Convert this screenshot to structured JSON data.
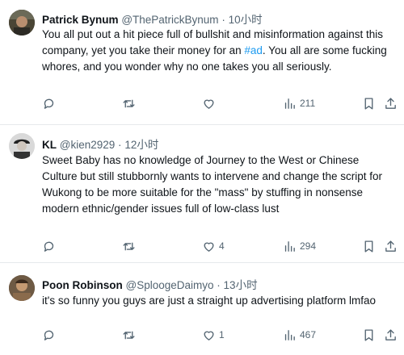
{
  "tweets": [
    {
      "display_name": "Patrick Bynum",
      "handle": "@ThePatrickBynum",
      "separator": "·",
      "time": "10小时",
      "text_before": "You all put out a hit piece full of bullshit and misinformation against this company, yet you take their money for an ",
      "hashtag": "#ad",
      "text_after": ". You all are some fucking whores, and you wonder why no one takes you all seriously.",
      "reply_count": "",
      "retweet_count": "",
      "like_count": "",
      "views_count": "211"
    },
    {
      "display_name": "KL",
      "handle": "@kien2929",
      "separator": "·",
      "time": "12小时",
      "text_before": "Sweet Baby has no knowledge of Journey to the West or Chinese Culture but still stubbornly wants to intervene and change the script for Wukong to be more suitable for the \"mass\" by stuffing in nonsense modern ethnic/gender issues full of low-class lust",
      "hashtag": "",
      "text_after": "",
      "reply_count": "",
      "retweet_count": "",
      "like_count": "4",
      "views_count": "294"
    },
    {
      "display_name": "Poon Robinson",
      "handle": "@SploogeDaimyo",
      "separator": "·",
      "time": "13小时",
      "text_before": "it's so funny you guys are just a straight up advertising platform lmfao",
      "hashtag": "",
      "text_after": "",
      "reply_count": "",
      "retweet_count": "",
      "like_count": "1",
      "views_count": "467"
    }
  ],
  "icons": {
    "reply": "reply-icon",
    "retweet": "retweet-icon",
    "like": "heart-icon",
    "views": "views-icon",
    "bookmark": "bookmark-icon",
    "share": "share-icon"
  },
  "colors": {
    "text": "#0f1419",
    "secondary": "#536471",
    "link": "#1d9bf0",
    "divider": "#e6e9ec"
  }
}
